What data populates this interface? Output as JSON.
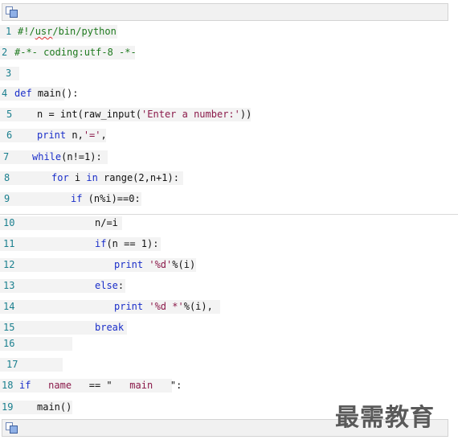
{
  "toolbar": {
    "copy_icon": "copy-icon"
  },
  "lines": [
    {
      "n": "1",
      "parts": [
        {
          "t": "#!/",
          "c": "cmt"
        },
        {
          "t": "usr",
          "c": "cmt underline-red"
        },
        {
          "t": "/bin/python",
          "c": "cmt"
        }
      ]
    },
    {
      "n": "2",
      "parts": [
        {
          "t": "#-*- coding:utf-8 -*-",
          "c": "cmt"
        }
      ]
    },
    {
      "n": "3",
      "parts": []
    },
    {
      "n": "4",
      "parts": [
        {
          "t": "def",
          "c": "kw"
        },
        {
          "t": " main():",
          "c": ""
        }
      ]
    },
    {
      "n": "5",
      "parts": [
        {
          "t": "n = int(raw_input(",
          "c": ""
        },
        {
          "t": "'Enter a number:'",
          "c": "str"
        },
        {
          "t": "))",
          "c": ""
        }
      ]
    },
    {
      "n": "6",
      "parts": [
        {
          "t": "print",
          "c": "kw"
        },
        {
          "t": " n,",
          "c": ""
        },
        {
          "t": "'='",
          "c": "str"
        },
        {
          "t": ",",
          "c": ""
        }
      ]
    },
    {
      "n": "7",
      "parts": [
        {
          "t": "while",
          "c": "kw"
        },
        {
          "t": "(n!=1):",
          "c": ""
        }
      ]
    },
    {
      "n": "8",
      "parts": [
        {
          "t": "for",
          "c": "kw"
        },
        {
          "t": " i ",
          "c": ""
        },
        {
          "t": "in",
          "c": "kw"
        },
        {
          "t": " range(2,n+1):",
          "c": ""
        }
      ]
    },
    {
      "n": "9",
      "parts": [
        {
          "t": "if",
          "c": "kw"
        },
        {
          "t": " (n%i)==0:",
          "c": ""
        }
      ]
    },
    {
      "n": "10",
      "parts": [
        {
          "t": "n/=i",
          "c": ""
        }
      ]
    },
    {
      "n": "11",
      "parts": [
        {
          "t": "if",
          "c": "kw"
        },
        {
          "t": "(n == 1):",
          "c": ""
        }
      ]
    },
    {
      "n": "12",
      "parts": [
        {
          "t": "print",
          "c": "kw"
        },
        {
          "t": " ",
          "c": ""
        },
        {
          "t": "'%d'",
          "c": "str"
        },
        {
          "t": "%(i)",
          "c": ""
        }
      ]
    },
    {
      "n": "13",
      "parts": [
        {
          "t": "else",
          "c": "kw"
        },
        {
          "t": ":",
          "c": ""
        }
      ]
    },
    {
      "n": "14",
      "parts": [
        {
          "t": "print",
          "c": "kw"
        },
        {
          "t": " ",
          "c": ""
        },
        {
          "t": "'%d *'",
          "c": "str"
        },
        {
          "t": "%(i),",
          "c": ""
        }
      ]
    },
    {
      "n": "15",
      "parts": [
        {
          "t": "break",
          "c": "kw"
        }
      ]
    },
    {
      "n": "16",
      "parts": []
    },
    {
      "n": "17",
      "parts": []
    },
    {
      "n": "18",
      "parts": [
        {
          "t": "if",
          "c": "kw"
        },
        {
          "t": "   ",
          "c": ""
        },
        {
          "t": "name",
          "c": "str"
        },
        {
          "t": "   == \"   ",
          "c": ""
        },
        {
          "t": "main",
          "c": "str"
        },
        {
          "t": "   \":",
          "c": ""
        }
      ]
    },
    {
      "n": "19",
      "parts": [
        {
          "t": "main()",
          "c": ""
        }
      ]
    }
  ],
  "watermark": "最需教育"
}
